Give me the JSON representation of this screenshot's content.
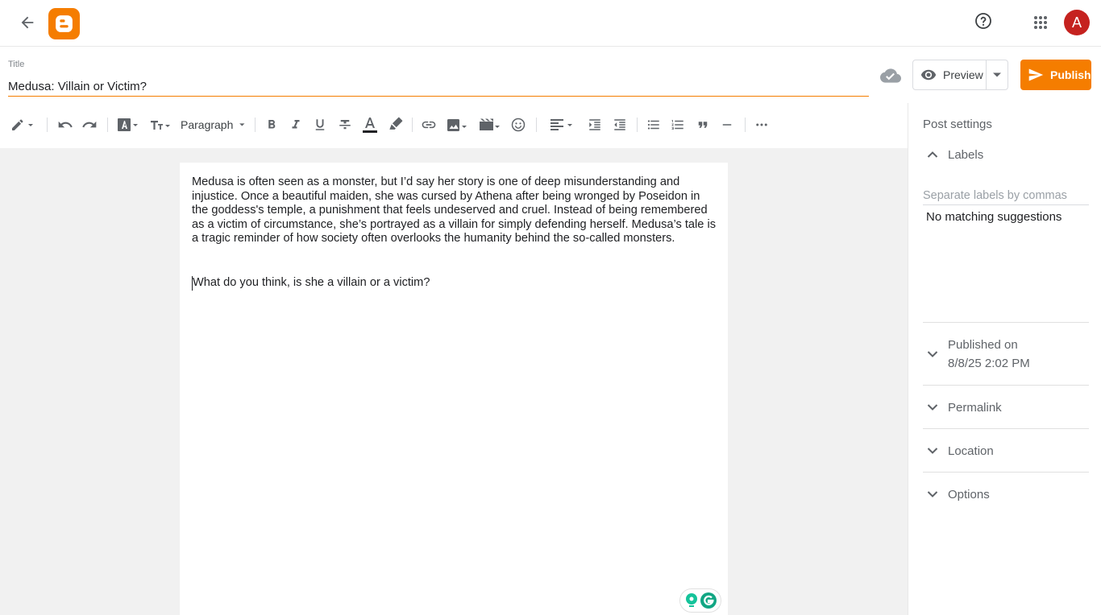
{
  "header": {
    "back_icon": "arrow-left-icon",
    "logo_icon": "blogger-logo-icon",
    "help_icon": "help-circle-icon",
    "apps_icon": "apps-grid-icon",
    "avatar_letter": "A",
    "brand_color": "#f57d00",
    "avatar_color": "#c5221f"
  },
  "post": {
    "title_label": "Title",
    "title_value": "Medusa: Villain or Victim?",
    "body_paragraph_1": "Medusa is often seen as a monster, but I’d say her story is one of deep misunderstanding and injustice. Once a beautiful maiden, she was cursed by Athena after being wronged by Poseidon in the goddess's temple, a punishment that feels undeserved and cruel. Instead of being remembered as a victim of circumstance, she’s portrayed as a villain for simply defending herself. Medusa’s tale is a tragic reminder of how society often overlooks the humanity behind the so-called monsters.",
    "body_paragraph_2": "What do you think, is she a villain or a victim?"
  },
  "actions": {
    "save_status_icon": "cloud-check-icon",
    "preview_label": "Preview",
    "publish_label": "Publish"
  },
  "toolbar": {
    "paragraph_style": "Paragraph",
    "tools": [
      "edit-mode",
      "undo",
      "redo",
      "font",
      "text-size",
      "paragraph",
      "bold",
      "italic",
      "underline",
      "strikethrough",
      "text-color",
      "highlight",
      "link",
      "image",
      "video",
      "emoji",
      "align",
      "indent",
      "outdent",
      "bulleted-list",
      "numbered-list",
      "quote",
      "horizontal-rule",
      "more"
    ]
  },
  "sidebar": {
    "title": "Post settings",
    "labels": {
      "heading": "Labels",
      "placeholder": "Separate labels by commas",
      "no_match": "No matching suggestions"
    },
    "published_on": {
      "heading": "Published on",
      "value": "8/8/25 2:02 PM"
    },
    "permalink": "Permalink",
    "location": "Location",
    "options": "Options"
  }
}
